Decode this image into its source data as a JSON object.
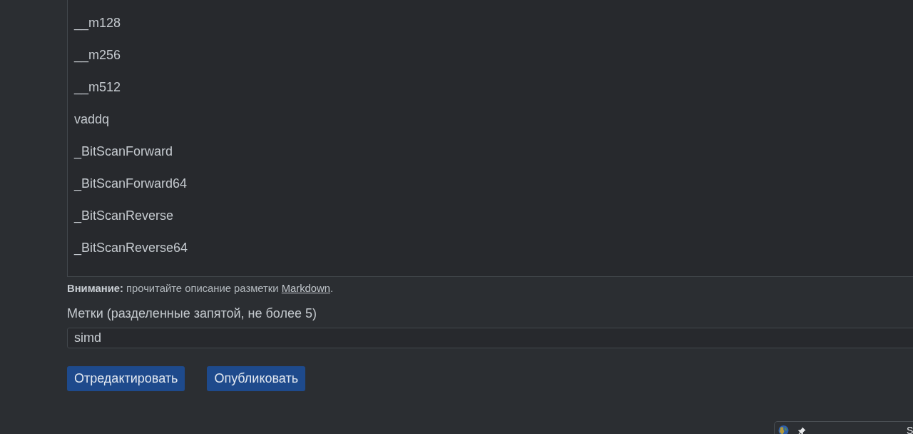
{
  "editor": {
    "lines": [
      "__m128",
      "__m256",
      "__m512",
      "vaddq",
      "_BitScanForward",
      "_BitScanForward64",
      "_BitScanReverse",
      "_BitScanReverse64"
    ]
  },
  "notice": {
    "text": "**Внимание:** прочитайте описание разметки",
    "link": "Markdown",
    "after": "."
  },
  "tags": {
    "label": "Метки (разделенные запятой, не более 5)",
    "value": "simd"
  },
  "buttons": [
    "Отредактировать",
    "Опубликовать"
  ],
  "popup": {
    "text": "S"
  }
}
